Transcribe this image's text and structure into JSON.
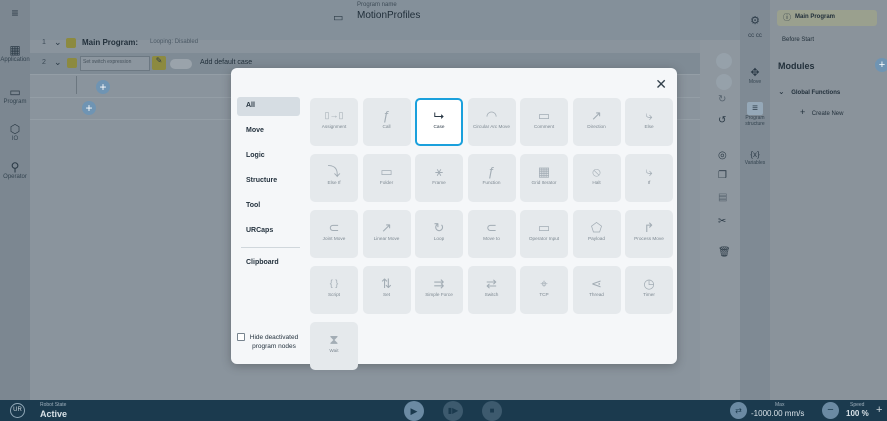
{
  "header": {
    "program_label": "Program name",
    "program_name": "MotionProfiles"
  },
  "leftnav": [
    {
      "label": "Application",
      "icon": "grid-icon"
    },
    {
      "label": "Program",
      "icon": "program-icon"
    },
    {
      "label": "IO",
      "icon": "io-icon"
    },
    {
      "label": "Operator",
      "icon": "operator-icon"
    }
  ],
  "tree": {
    "row1_num": "1",
    "row1_title": "Main Program:",
    "row1_sub": "Looping: Disabled",
    "row2_num": "2",
    "row2_placeholder": "Set switch expression",
    "row2_default": "Add default case"
  },
  "rail": {
    "move": "Move",
    "program_structure": "Program structure",
    "variables": "Variables"
  },
  "right_panel": {
    "main_program": "Main Program",
    "before_start": "Before Start",
    "modules": "Modules",
    "global_functions": "Global Functions",
    "create_new": "Create New"
  },
  "modal": {
    "categories": [
      "All",
      "Move",
      "Logic",
      "Structure",
      "Tool",
      "URCaps",
      "Clipboard"
    ],
    "active_category": "All",
    "hide_deactivated": "Hide deactivated program nodes",
    "nodes": [
      {
        "label": "Assignment",
        "icon": "assignment-icon"
      },
      {
        "label": "Call",
        "icon": "function-call-icon"
      },
      {
        "label": "Case",
        "icon": "case-icon"
      },
      {
        "label": "Circular Arc Move",
        "icon": "circular-arc-icon"
      },
      {
        "label": "Comment",
        "icon": "comment-icon"
      },
      {
        "label": "Direction",
        "icon": "direction-icon"
      },
      {
        "label": "Else",
        "icon": "else-icon"
      },
      {
        "label": "Else If",
        "icon": "else-if-icon"
      },
      {
        "label": "Folder",
        "icon": "folder-icon"
      },
      {
        "label": "Frame",
        "icon": "frame-icon"
      },
      {
        "label": "Function",
        "icon": "function-icon"
      },
      {
        "label": "Grid Iterator",
        "icon": "grid-iterator-icon"
      },
      {
        "label": "Halt",
        "icon": "halt-icon"
      },
      {
        "label": "If",
        "icon": "if-icon"
      },
      {
        "label": "Joint Move",
        "icon": "joint-move-icon"
      },
      {
        "label": "Linear Move",
        "icon": "linear-move-icon"
      },
      {
        "label": "Loop",
        "icon": "loop-icon"
      },
      {
        "label": "Move to",
        "icon": "move-to-icon"
      },
      {
        "label": "Operator Input",
        "icon": "operator-input-icon"
      },
      {
        "label": "Payload",
        "icon": "payload-icon"
      },
      {
        "label": "Process Move",
        "icon": "process-move-icon"
      },
      {
        "label": "Script",
        "icon": "script-icon"
      },
      {
        "label": "Set",
        "icon": "set-icon"
      },
      {
        "label": "Simple Force",
        "icon": "simple-force-icon"
      },
      {
        "label": "Switch",
        "icon": "switch-icon"
      },
      {
        "label": "TCP",
        "icon": "tcp-icon"
      },
      {
        "label": "Thread",
        "icon": "thread-icon"
      },
      {
        "label": "Timer",
        "icon": "timer-icon"
      },
      {
        "label": "Wait",
        "icon": "wait-icon"
      }
    ],
    "selected": "Case"
  },
  "footer": {
    "robot_state_label": "Robot State",
    "robot_state": "Active",
    "max_label": "Max",
    "max_value": "-1000.00 mm/s",
    "speed_label": "Speed",
    "speed_value": "100 %"
  },
  "colors": {
    "accent": "#1aa0dc",
    "footer_bg": "#1b3a4e"
  }
}
